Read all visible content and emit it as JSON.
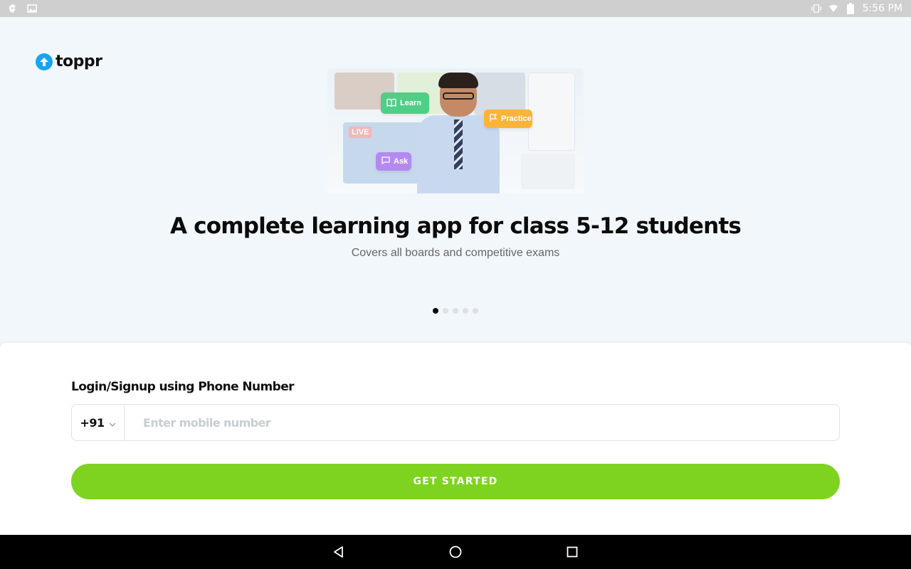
{
  "status_bar": {
    "time": "5:56 PM",
    "left_icons": [
      "hangouts-icon",
      "image-icon"
    ],
    "right_icons": [
      "vibrate-icon",
      "wifi-icon",
      "battery-icon"
    ]
  },
  "app": {
    "logo_text": "toppr",
    "brand_color": "#1aa3f0"
  },
  "hero": {
    "chips": {
      "learn": "Learn",
      "practice": "Practice",
      "ask": "Ask"
    },
    "live_tag": "LIVE",
    "headline": "A complete learning app for class 5-12 students",
    "subline": "Covers all boards and competitive exams",
    "carousel": {
      "total_pages": 5,
      "active_page": 1
    }
  },
  "login": {
    "title": "Login/Signup using Phone Number",
    "country_code": "+91",
    "phone_value": "",
    "phone_placeholder": "Enter mobile number",
    "cta_label": "GET STARTED",
    "cta_color": "#7ed321"
  },
  "nav_bar": {
    "buttons": [
      "back-icon",
      "home-icon",
      "recents-icon"
    ]
  }
}
